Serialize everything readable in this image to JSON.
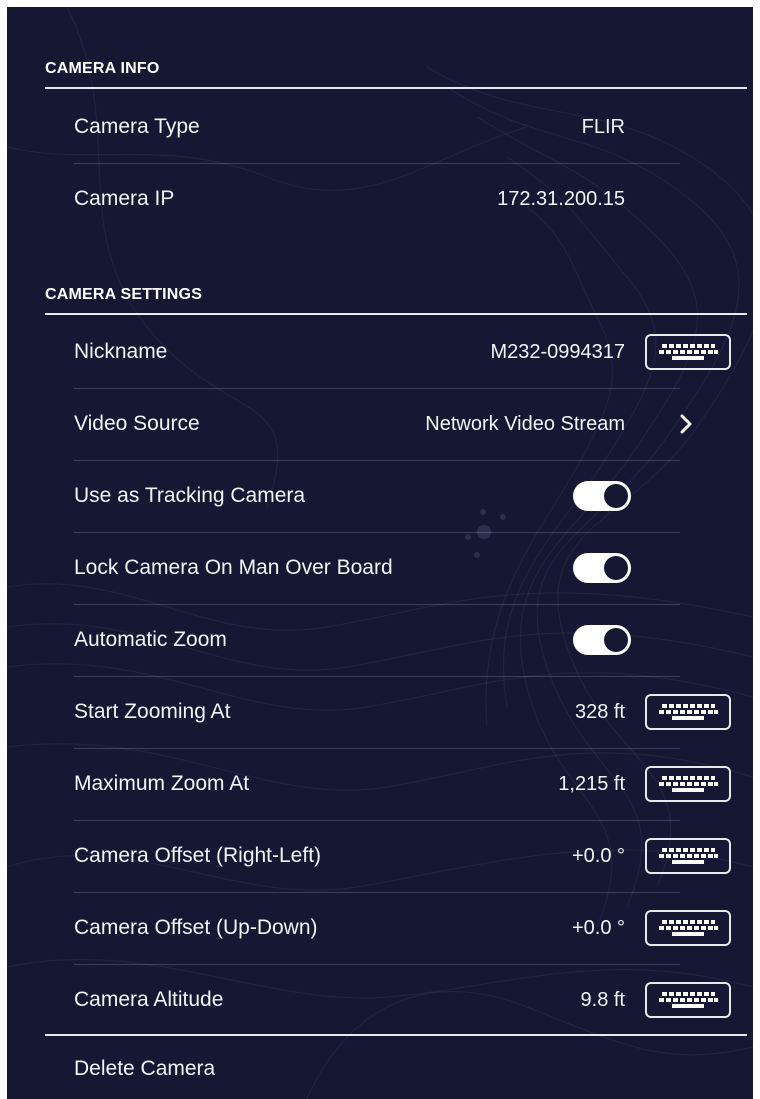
{
  "camera_info": {
    "header": "CAMERA INFO",
    "rows": [
      {
        "label": "Camera Type",
        "value": "FLIR"
      },
      {
        "label": "Camera IP",
        "value": "172.31.200.15"
      }
    ]
  },
  "camera_settings": {
    "header": "CAMERA SETTINGS",
    "nickname": {
      "label": "Nickname",
      "value": "M232-0994317",
      "control": "keyboard-icon"
    },
    "video_source": {
      "label": "Video Source",
      "value": "Network Video Stream",
      "control": "chevron-right-icon"
    },
    "use_tracking": {
      "label": "Use as Tracking Camera",
      "state": "on"
    },
    "lock_mob": {
      "label": "Lock Camera On Man Over Board",
      "state": "on"
    },
    "auto_zoom": {
      "label": "Automatic Zoom",
      "state": "on"
    },
    "start_zoom": {
      "label": "Start Zooming At",
      "value": "328 ft",
      "control": "keyboard-icon"
    },
    "max_zoom": {
      "label": "Maximum Zoom At",
      "value": "1,215 ft",
      "control": "keyboard-icon"
    },
    "offset_rl": {
      "label": "Camera Offset (Right-Left)",
      "value": "+0.0 °",
      "control": "keyboard-icon"
    },
    "offset_ud": {
      "label": "Camera Offset (Up-Down)",
      "value": "+0.0 °",
      "control": "keyboard-icon"
    },
    "altitude": {
      "label": "Camera Altitude",
      "value": "9.8 ft",
      "control": "keyboard-icon"
    }
  },
  "delete_camera": {
    "label": "Delete Camera"
  },
  "colors": {
    "background": "#151733",
    "text": "#f1f2f6",
    "toggle_on": "#ffffff"
  }
}
